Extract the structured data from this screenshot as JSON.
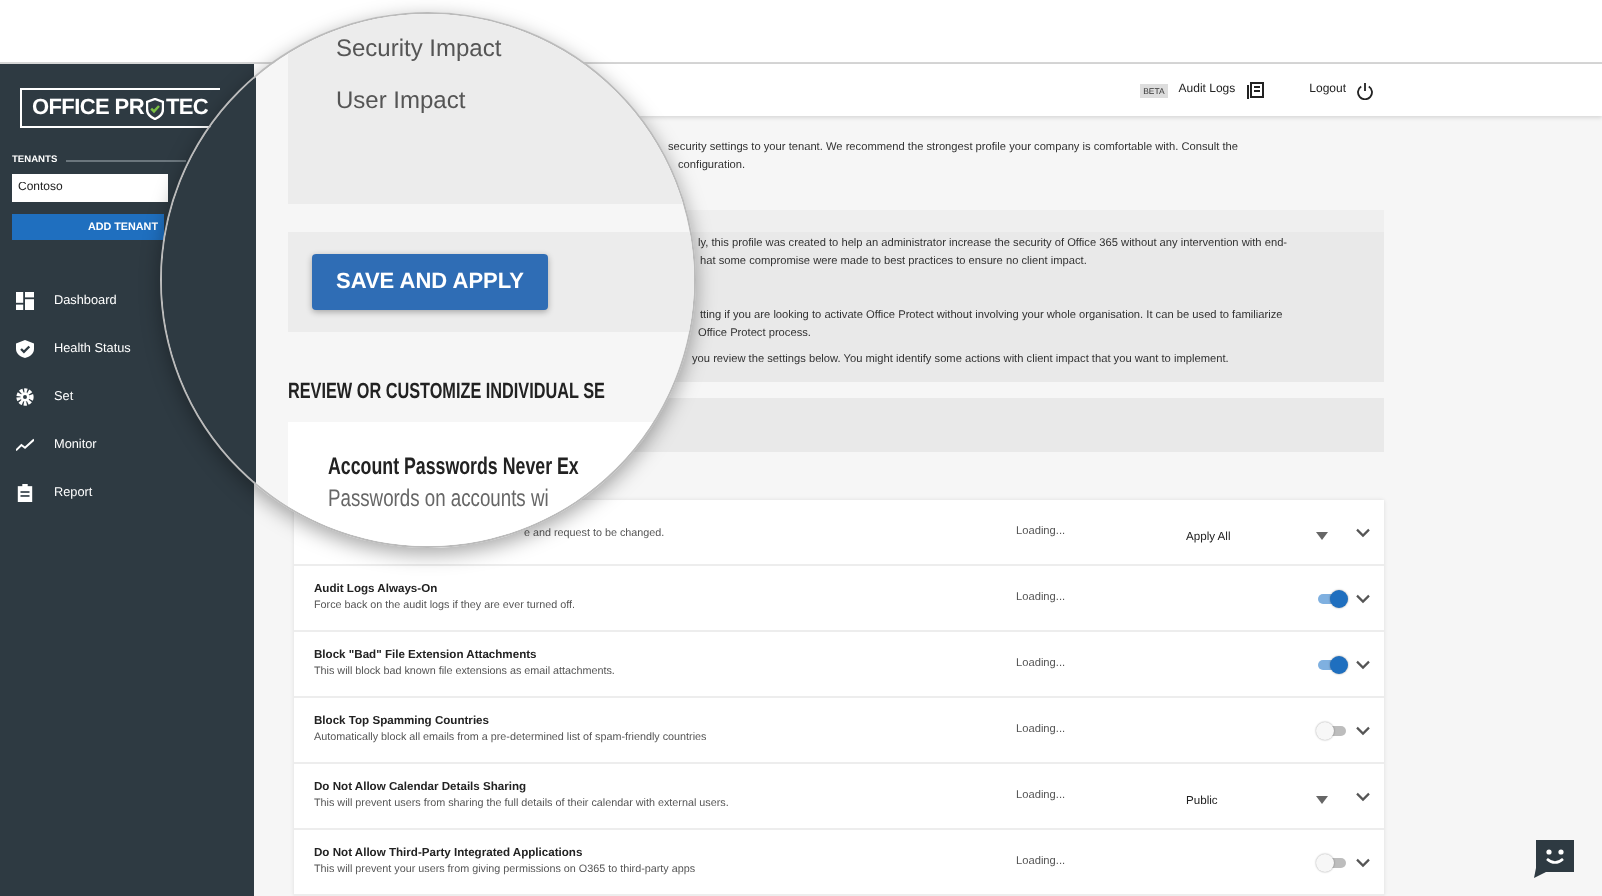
{
  "sidebar": {
    "logo_left": "OFFICE PR",
    "logo_right": "TEC",
    "tenants_label": "TENANTS",
    "tenant_field": {
      "value": "Contoso"
    },
    "add_tenant_button": "ADD TENANT",
    "items": [
      {
        "label": "Dashboard"
      },
      {
        "label": "Health Status"
      },
      {
        "label": "Set"
      },
      {
        "label": "Monitor"
      },
      {
        "label": "Report"
      }
    ]
  },
  "header": {
    "badge": "BETA",
    "audit_logs": "Audit Logs",
    "logout": "Logout"
  },
  "intro_lines": [
    "security settings to your tenant. We recommend the strongest profile your company is comfortable with. Consult the",
    "configuration."
  ],
  "profile_lines": [
    "ly, this profile was created to help an administrator increase the security of Office 365 without any intervention with end-",
    "hat some compromise were made to best practices to ensure no client impact.",
    "tting if you are looking to activate Office Protect without involving your whole organisation. It can be used to familiarize",
    "Office Protect process.",
    "you review the settings below. You might identify some actions with client impact that you want to implement."
  ],
  "magnifier": {
    "impact_labels": [
      "Security Impact",
      "User Impact"
    ],
    "save_button": "SAVE AND APPLY",
    "section_heading": "REVIEW OR CUSTOMIZE INDIVIDUAL SE",
    "card_title": "Account Passwords Never Ex",
    "card_subtitle": "Passwords on accounts wi"
  },
  "settings": [
    {
      "kind": "select",
      "description": "e and request to be changed.",
      "status": "Loading...",
      "value": "Apply All"
    },
    {
      "kind": "toggle",
      "title": "Audit Logs Always-On",
      "description": "Force back on the audit logs if they are ever turned off.",
      "status": "Loading...",
      "on": true
    },
    {
      "kind": "toggle",
      "title": "Block \"Bad\" File Extension Attachments",
      "description": "This will block bad known file extensions as email attachments.",
      "status": "Loading...",
      "on": true
    },
    {
      "kind": "toggle",
      "title": "Block Top Spamming Countries",
      "description": "Automatically block all emails from a pre-determined list of spam-friendly countries",
      "status": "Loading...",
      "on": false
    },
    {
      "kind": "select",
      "title": "Do Not Allow Calendar Details Sharing",
      "description": "This will prevent users from sharing the full details of their calendar with external users.",
      "status": "Loading...",
      "value": "Public"
    },
    {
      "kind": "toggle",
      "title": "Do Not Allow Third-Party Integrated Applications",
      "description": "This will prevent your users from giving permissions on O365 to third-party apps",
      "status": "Loading...",
      "on": false
    }
  ]
}
